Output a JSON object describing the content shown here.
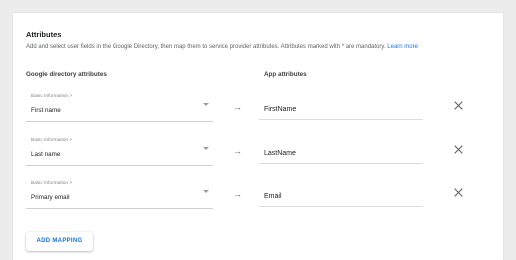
{
  "attributes": {
    "title": "Attributes",
    "description": "Add and select user fields in the Google Directory, then map them to service provider attributes. Attributes marked with * are mandatory.",
    "learn_more": "Learn more",
    "col_google": "Google directory attributes",
    "col_app": "App attributes",
    "arrow_glyph": "→",
    "mappings": [
      {
        "category": "Basic Information >",
        "google_attr": "First name",
        "app_attr": "FirstName"
      },
      {
        "category": "Basic Information >",
        "google_attr": "Last name",
        "app_attr": "LastName"
      },
      {
        "category": "Basic Information >",
        "google_attr": "Primary email",
        "app_attr": "Email"
      }
    ],
    "add_mapping_label": "ADD MAPPING"
  },
  "icons": {
    "dropdown": "chevron-down-icon",
    "arrow": "arrow-right-icon",
    "remove": "close-icon"
  },
  "colors": {
    "link": "#1a73e8",
    "button_text": "#1a73e8"
  }
}
